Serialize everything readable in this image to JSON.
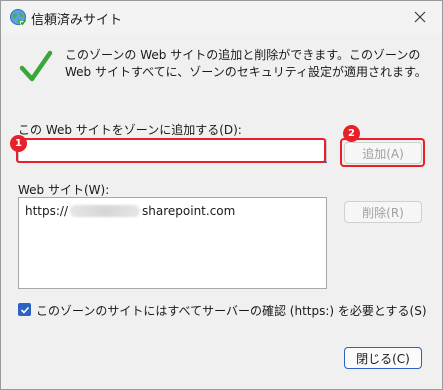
{
  "window": {
    "title": "信頼済みサイト",
    "title_icon": "internet-globe-icon",
    "close_icon": "close-icon"
  },
  "description": "このゾーンの Web サイトの追加と削除ができます。このゾーンの Web サイトすべてに、ゾーンのセキュリティ設定が適用されます。",
  "add_site": {
    "label": "この Web サイトをゾーンに追加する(D):",
    "value": "",
    "button_label": "追加(A)"
  },
  "sites": {
    "label": "Web サイト(W):",
    "items": [
      {
        "prefix": "https://",
        "suffix": "sharepoint.com"
      }
    ],
    "remove_label": "削除(R)"
  },
  "https_requirement": {
    "label": "このゾーンのサイトにはすべてサーバーの確認 (https:) を必要とする(S)",
    "checked": true
  },
  "close_label": "閉じる(C)",
  "annotations": {
    "badge_1": "1",
    "badge_2": "2"
  },
  "colors": {
    "highlight": "#e8202a",
    "accent": "#2b62c4",
    "check_green": "#3aa63a"
  }
}
